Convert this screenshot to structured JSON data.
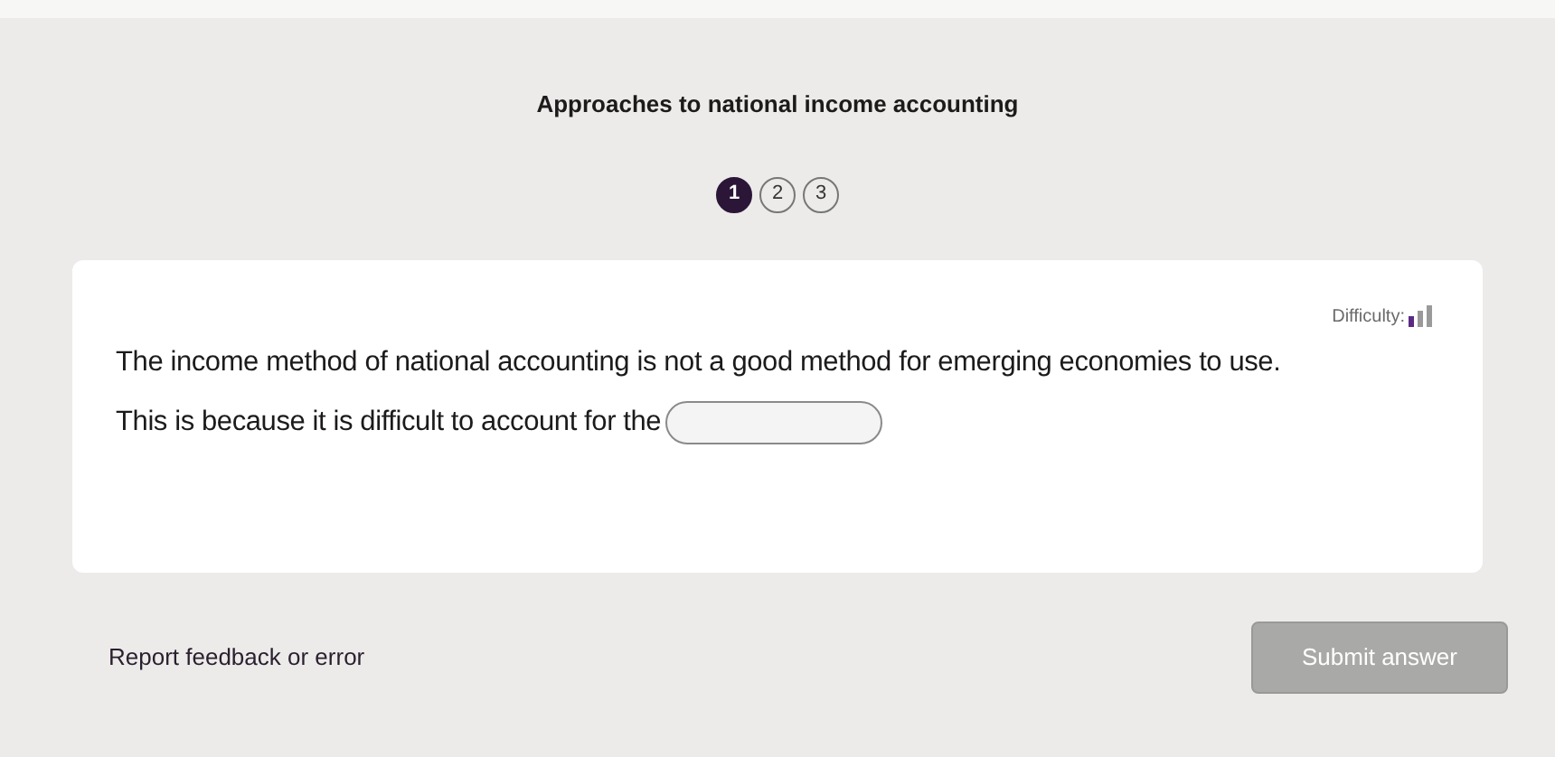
{
  "title": "Approaches to national income accounting",
  "steps": [
    {
      "label": "1",
      "selected": true
    },
    {
      "label": "2",
      "selected": false
    },
    {
      "label": "3",
      "selected": false
    }
  ],
  "question": {
    "difficulty_label": "Difficulty:",
    "sentence_1": "The income method of national accounting is not a good method for emerging economies to use.",
    "sentence_2": "This is because it is difficult to account for the"
  },
  "footer": {
    "link": "Report feedback or error",
    "submit": {
      "label": "Submit answer",
      "disabled": true
    }
  }
}
